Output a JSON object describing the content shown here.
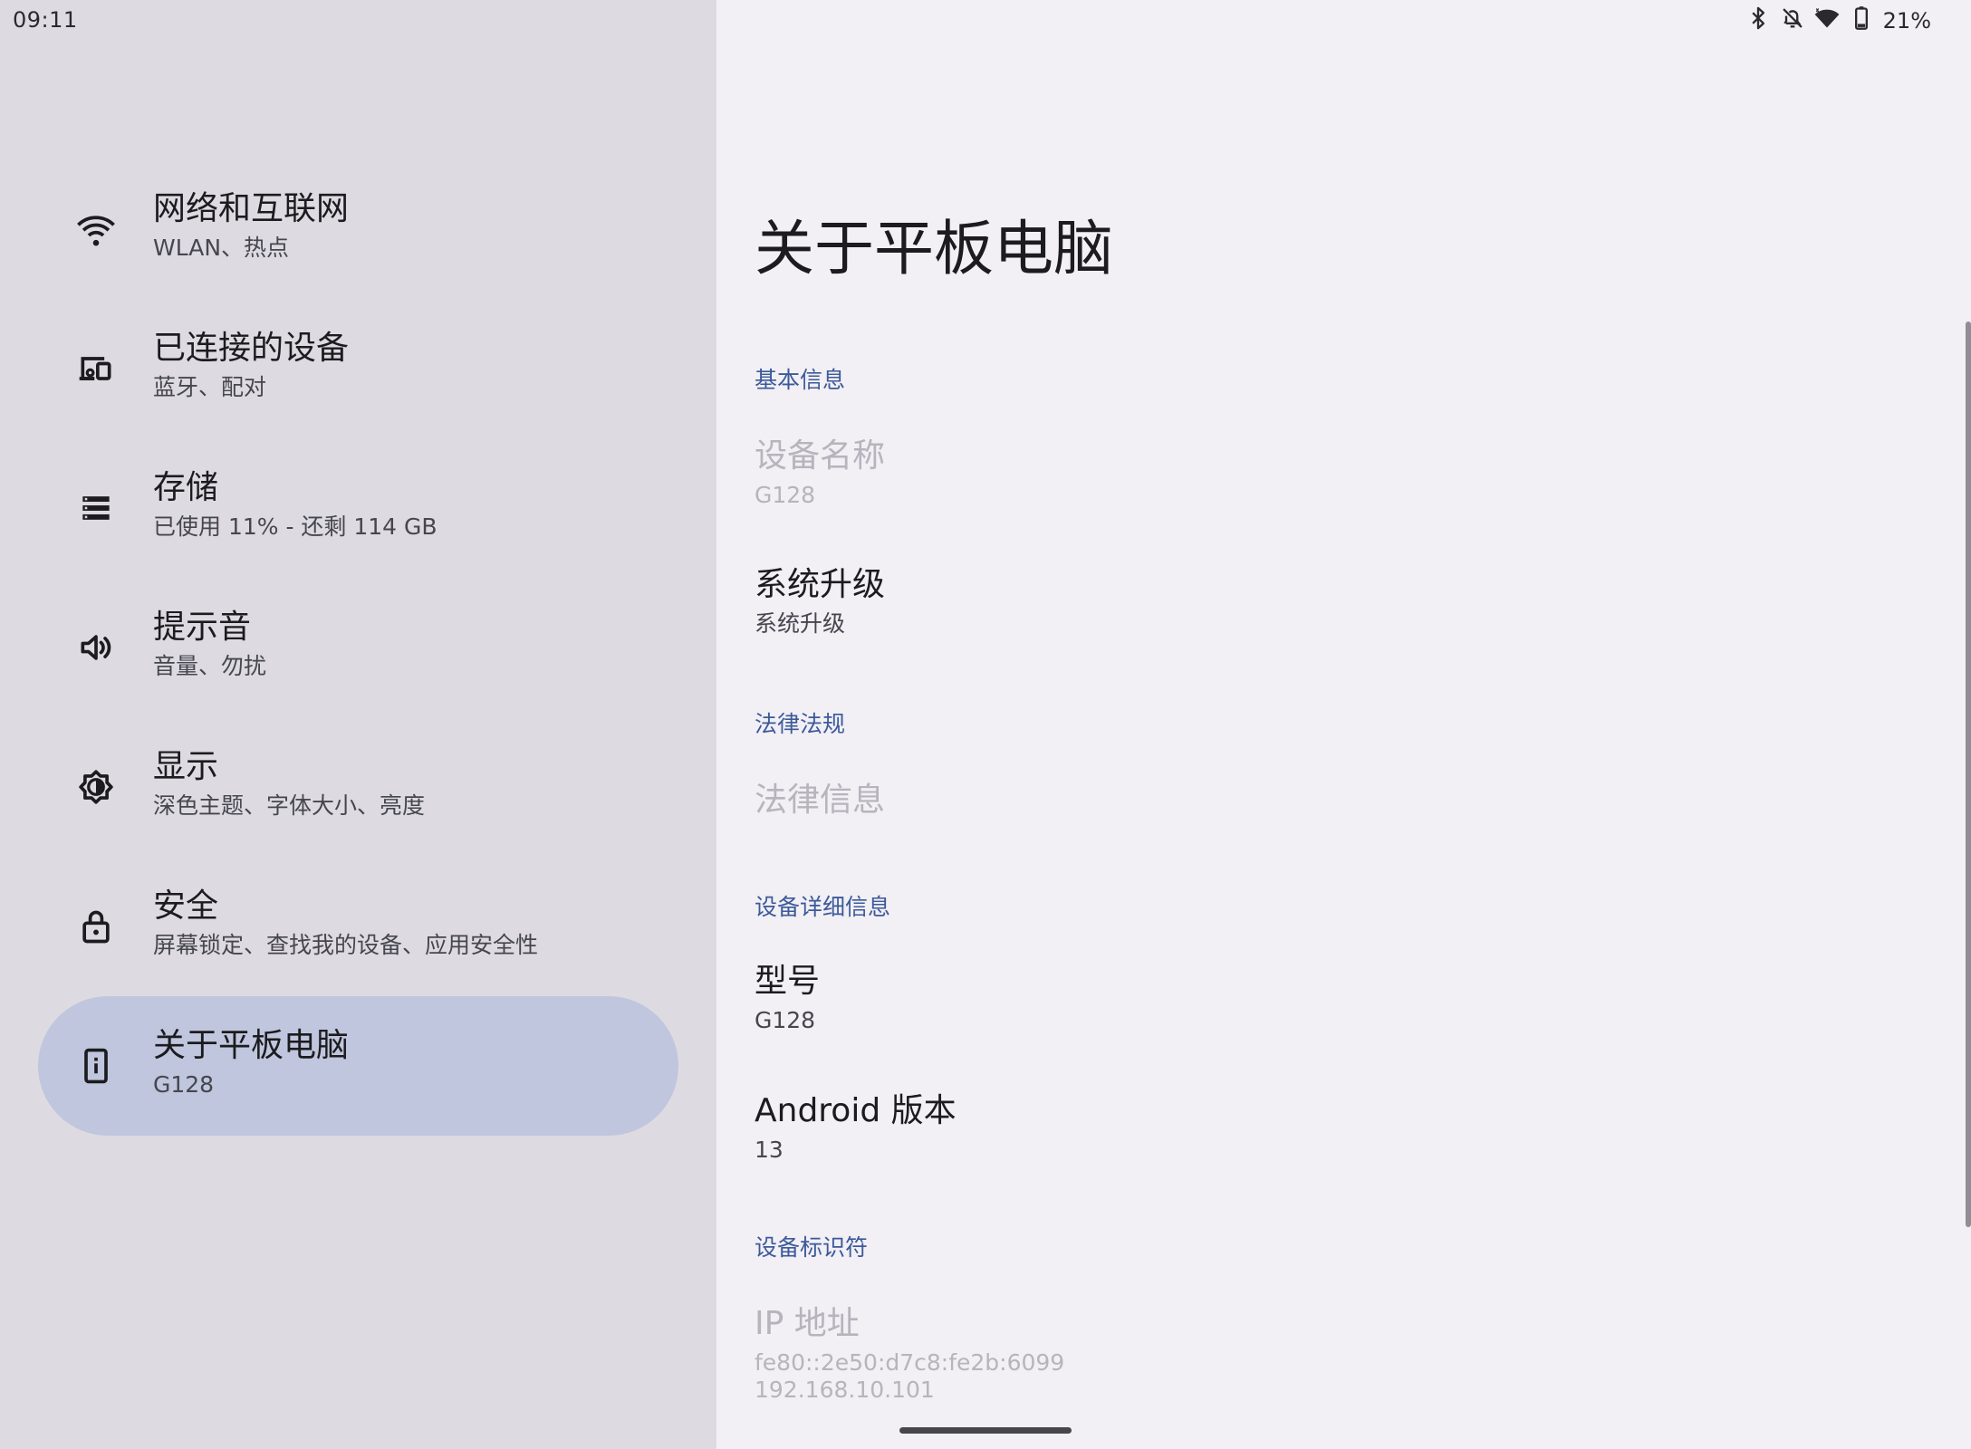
{
  "status_bar": {
    "time": "09:11",
    "battery": "21%",
    "icons": [
      "bluetooth-icon",
      "notifications-off-icon",
      "wifi-icon",
      "battery-icon"
    ]
  },
  "sidebar": {
    "items": [
      {
        "title": "网络和互联网",
        "subtitle": "WLAN、热点",
        "icon": "wifi-icon"
      },
      {
        "title": "已连接的设备",
        "subtitle": "蓝牙、配对",
        "icon": "devices-icon"
      },
      {
        "title": "存储",
        "subtitle": "已使用 11% - 还剩 114 GB",
        "icon": "storage-icon"
      },
      {
        "title": "提示音",
        "subtitle": "音量、勿扰",
        "icon": "volume-icon"
      },
      {
        "title": "显示",
        "subtitle": "深色主题、字体大小、亮度",
        "icon": "brightness-icon"
      },
      {
        "title": "安全",
        "subtitle": "屏幕锁定、查找我的设备、应用安全性",
        "icon": "lock-icon"
      },
      {
        "title": "关于平板电脑",
        "subtitle": "G128",
        "icon": "tablet-info-icon",
        "selected": true
      }
    ]
  },
  "main": {
    "title": "关于平板电脑",
    "sections": {
      "basic": "基本信息",
      "legal": "法律法规",
      "details": "设备详细信息",
      "identifiers": "设备标识符"
    },
    "prefs": {
      "device_name": {
        "title": "设备名称",
        "value": "G128"
      },
      "system_update": {
        "title": "系统升级",
        "value": "系统升级"
      },
      "legal_info": {
        "title": "法律信息"
      },
      "model": {
        "title": "型号",
        "value": "G128"
      },
      "android_version": {
        "title": "Android 版本",
        "value": "13"
      },
      "ip_address": {
        "title": "IP 地址",
        "value_v6": "fe80::2e50:d7c8:fe2b:6099",
        "value_v4": "192.168.10.101"
      }
    }
  }
}
